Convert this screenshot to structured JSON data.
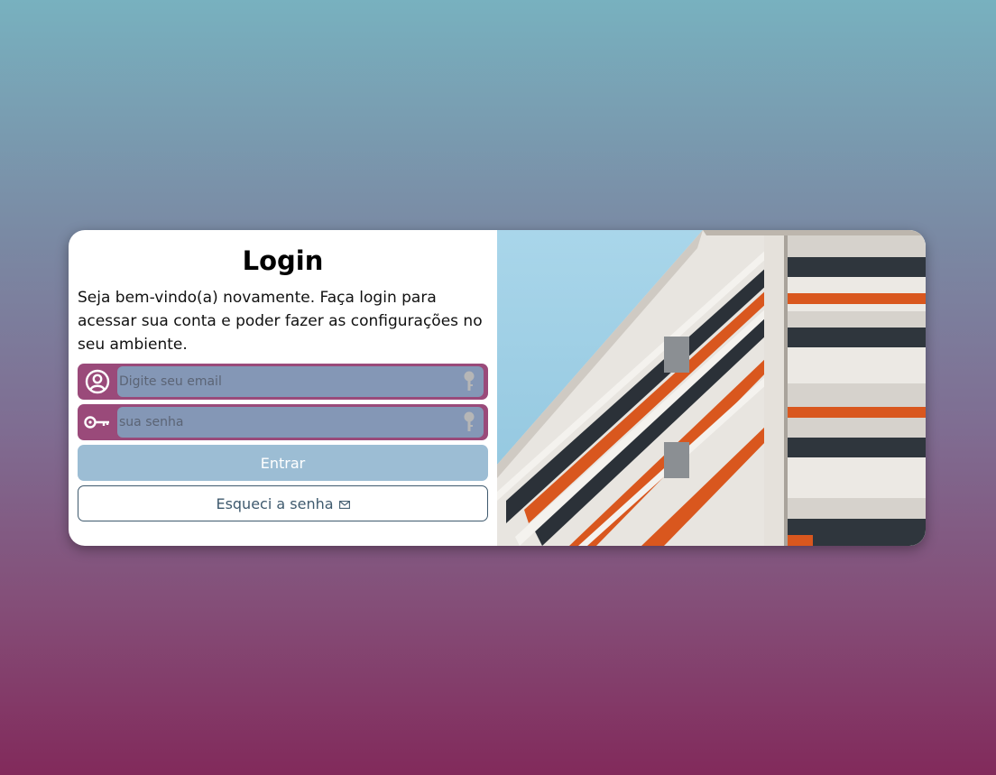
{
  "login": {
    "title": "Login",
    "welcome_text": "Seja bem-vindo(a) novamente. Faça login para acessar sua conta e poder fazer as configurações no seu ambiente.",
    "email": {
      "placeholder": "Digite seu email",
      "value": "",
      "icon": "user-circle-icon"
    },
    "password": {
      "placeholder": "sua senha",
      "value": "",
      "icon": "key-icon"
    },
    "submit_label": "Entrar",
    "forgot_label": "Esqueci a senha",
    "forgot_icon": "envelope-icon"
  },
  "colors": {
    "field_background": "#9a4a7a",
    "input_fill": "#8497b6",
    "enter_button": "#9cbdd4",
    "forgot_border": "#3f5a6e"
  },
  "image": {
    "icon": "building-photo"
  }
}
